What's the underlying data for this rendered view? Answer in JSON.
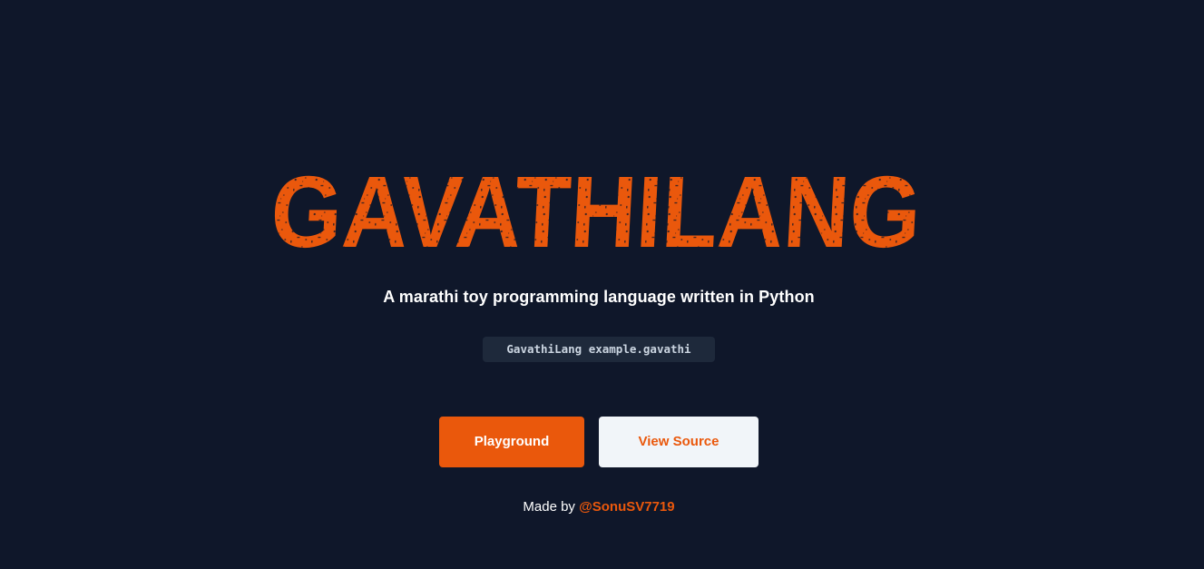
{
  "hero": {
    "logo_text": "GAVATHILANG",
    "tagline": "A marathi toy programming language written in Python",
    "command": "GavathiLang example.gavathi"
  },
  "buttons": {
    "playground_label": "Playground",
    "view_source_label": "View Source"
  },
  "footer": {
    "prefix": "Made by",
    "author": "@SonuSV7719"
  },
  "colors": {
    "background": "#0f172a",
    "accent": "#ea580c",
    "code_bg": "#1e293b",
    "secondary_button_bg": "#f1f5f9"
  }
}
